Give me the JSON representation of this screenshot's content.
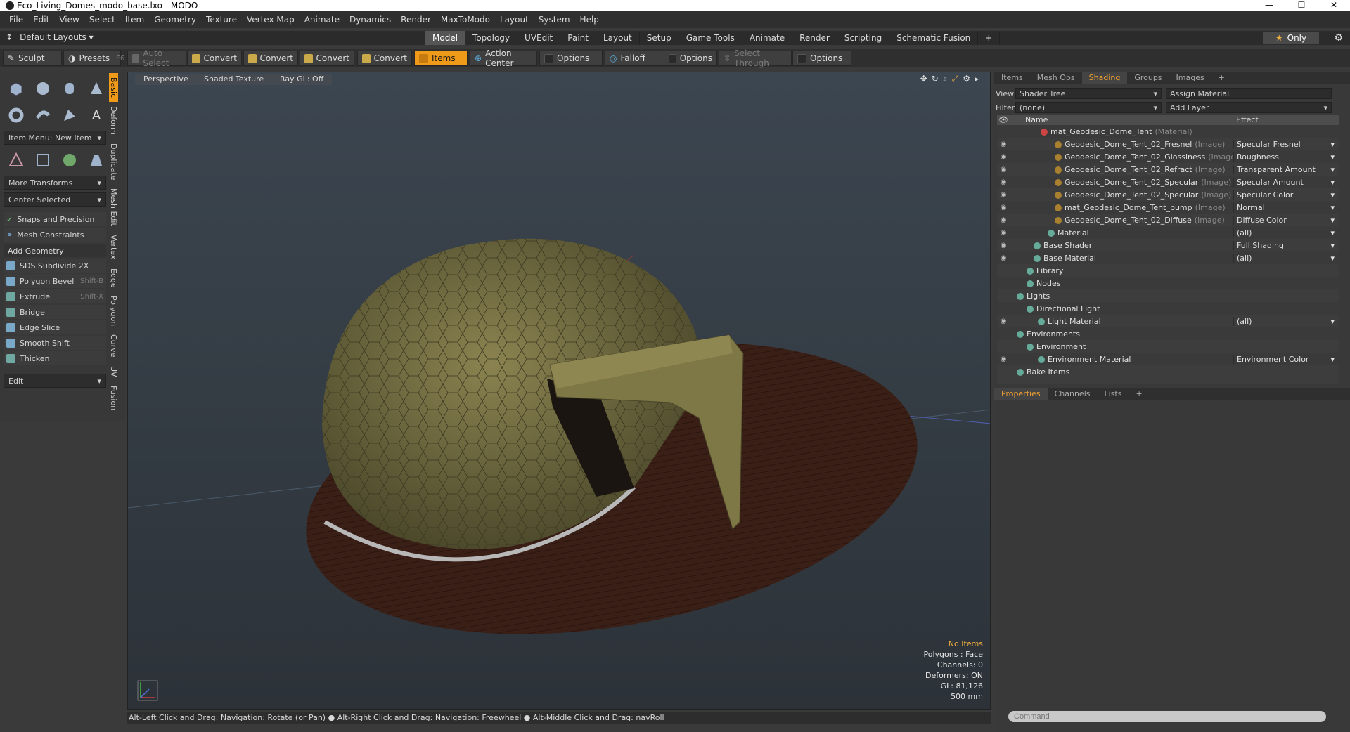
{
  "window": {
    "title": "Eco_Living_Domes_modo_base.lxo - MODO",
    "controls": [
      "—",
      "☐",
      "✕"
    ]
  },
  "menu": [
    "File",
    "Edit",
    "View",
    "Select",
    "Item",
    "Geometry",
    "Texture",
    "Vertex Map",
    "Animate",
    "Dynamics",
    "Render",
    "MaxToModo",
    "Layout",
    "System",
    "Help"
  ],
  "layout_bar": {
    "layouts_label": "Default Layouts ▾",
    "tabs": [
      "Model",
      "Topology",
      "UVEdit",
      "Paint",
      "Layout",
      "Setup",
      "Game Tools",
      "Animate",
      "Render",
      "Scripting",
      "Schematic Fusion",
      "+"
    ],
    "active_tab": "Model",
    "only_label": "Only"
  },
  "toolbar": {
    "sculpt": "Sculpt",
    "presets": "Presets",
    "presets_key": "F6",
    "auto_select": "Auto Select",
    "convert1": "Convert",
    "convert2": "Convert",
    "convert3": "Convert",
    "convert4": "Convert",
    "items": "Items",
    "action_center": "Action Center",
    "options1": "Options",
    "falloff": "Falloff",
    "options2": "Options",
    "select_through": "Select Through",
    "options3": "Options"
  },
  "left_panel": {
    "item_menu": "Item Menu: New Item",
    "more_transforms": "More Transforms",
    "center_selected": "Center Selected",
    "snaps": "Snaps and Precision",
    "mesh_constraints": "Mesh Constraints",
    "add_geometry": "Add Geometry",
    "tools": [
      {
        "label": "SDS Subdivide 2X",
        "key": ""
      },
      {
        "label": "Polygon Bevel",
        "key": "Shift-B"
      },
      {
        "label": "Extrude",
        "key": "Shift-X"
      },
      {
        "label": "Bridge",
        "key": ""
      },
      {
        "label": "Edge Slice",
        "key": ""
      },
      {
        "label": "Smooth Shift",
        "key": ""
      },
      {
        "label": "Thicken",
        "key": ""
      }
    ],
    "edit_dropdown": "Edit",
    "vtabs": [
      "Basic",
      "Deform",
      "Duplicate",
      "Mesh Edit",
      "Vertex",
      "Edge",
      "Polygon",
      "Curve",
      "UV",
      "Fusion"
    ]
  },
  "viewport": {
    "perspective": "Perspective",
    "shading": "Shaded Texture",
    "raygl": "Ray GL: Off",
    "info": {
      "no_items": "No Items",
      "polygons": "Polygons : Face",
      "channels": "Channels: 0",
      "deformers": "Deformers: ON",
      "gl": "GL: 81,126",
      "scale": "500 mm"
    }
  },
  "status_bar": "Alt-Left Click and Drag: Navigation: Rotate (or Pan) ● Alt-Right Click and Drag: Navigation: Freewheel ● Alt-Middle Click and Drag: navRoll",
  "right_panel": {
    "tabs": [
      "Items",
      "Mesh Ops",
      "Shading",
      "Groups",
      "Images",
      "+"
    ],
    "active_tab": "Shading",
    "view_label": "View",
    "view_value": "Shader Tree",
    "assign_material": "Assign Material",
    "filter_label": "Filter",
    "filter_value": "(none)",
    "add_layer": "Add Layer",
    "col_name": "Name",
    "col_effect": "Effect",
    "rows": [
      {
        "name": "mat_Geodesic_Dome_Tent",
        "tag": "(Material)",
        "effect": "",
        "indent": 40
      },
      {
        "name": "Geodesic_Dome_Tent_02_Fresnel",
        "tag": "(Image)",
        "effect": "Specular Fresnel",
        "indent": 60
      },
      {
        "name": "Geodesic_Dome_Tent_02_Glossiness",
        "tag": "(Image)",
        "effect": "Roughness",
        "indent": 60
      },
      {
        "name": "Geodesic_Dome_Tent_02_Refract",
        "tag": "(Image)",
        "effect": "Transparent Amount",
        "indent": 60
      },
      {
        "name": "Geodesic_Dome_Tent_02_Specular",
        "tag": "(Image)",
        "effect": "Specular Amount",
        "indent": 60
      },
      {
        "name": "Geodesic_Dome_Tent_02_Specular",
        "tag": "(Image)",
        "effect": "Specular Color",
        "indent": 60
      },
      {
        "name": "mat_Geodesic_Dome_Tent_bump",
        "tag": "(Image)",
        "effect": "Normal",
        "indent": 60
      },
      {
        "name": "Geodesic_Dome_Tent_02_Diffuse",
        "tag": "(Image)",
        "effect": "Diffuse Color",
        "indent": 60
      },
      {
        "name": "Material",
        "tag": "",
        "effect": "(all)",
        "indent": 50
      },
      {
        "name": "Base Shader",
        "tag": "",
        "effect": "Full Shading",
        "indent": 30
      },
      {
        "name": "Base Material",
        "tag": "",
        "effect": "(all)",
        "indent": 30
      },
      {
        "name": "Library",
        "tag": "",
        "effect": "",
        "indent": 20
      },
      {
        "name": "Nodes",
        "tag": "",
        "effect": "",
        "indent": 20
      },
      {
        "name": "Lights",
        "tag": "",
        "effect": "",
        "indent": 6
      },
      {
        "name": "Directional Light",
        "tag": "",
        "effect": "",
        "indent": 20
      },
      {
        "name": "Light Material",
        "tag": "",
        "effect": "(all)",
        "indent": 36
      },
      {
        "name": "Environments",
        "tag": "",
        "effect": "",
        "indent": 6
      },
      {
        "name": "Environment",
        "tag": "",
        "effect": "",
        "indent": 20
      },
      {
        "name": "Environment Material",
        "tag": "",
        "effect": "Environment Color",
        "indent": 36
      },
      {
        "name": "Bake Items",
        "tag": "",
        "effect": "",
        "indent": 6
      }
    ],
    "props_tabs": [
      "Properties",
      "Channels",
      "Lists",
      "+"
    ],
    "props_active": "Properties",
    "command_placeholder": "Command"
  }
}
